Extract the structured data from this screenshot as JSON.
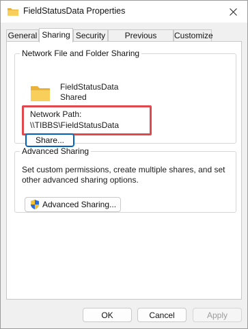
{
  "window": {
    "title": "FieldStatusData Properties"
  },
  "tabs": [
    {
      "label": "General",
      "active": false
    },
    {
      "label": "Sharing",
      "active": true
    },
    {
      "label": "Security",
      "active": false
    },
    {
      "label": "Previous Versions",
      "active": false
    },
    {
      "label": "Customize",
      "active": false
    }
  ],
  "network_sharing": {
    "legend": "Network File and Folder Sharing",
    "share_name": "FieldStatusData",
    "share_status": "Shared",
    "network_path_label": "Network Path:",
    "network_path_value": "\\\\TIBBS\\FieldStatusData",
    "share_button": "Share...",
    "highlight_color": "#e0484e"
  },
  "advanced_sharing": {
    "legend": "Advanced Sharing",
    "description": "Set custom permissions, create multiple shares, and set other advanced sharing options.",
    "button": "Advanced Sharing..."
  },
  "dialog_buttons": {
    "ok": "OK",
    "cancel": "Cancel",
    "apply": "Apply",
    "apply_enabled": false
  },
  "colors": {
    "accent": "#005fb8",
    "folder": "#f4c542"
  },
  "icons": {
    "window_icon": "folder-icon",
    "close": "close-icon",
    "shared_folder": "folder-icon",
    "uac": "uac-shield-icon"
  }
}
